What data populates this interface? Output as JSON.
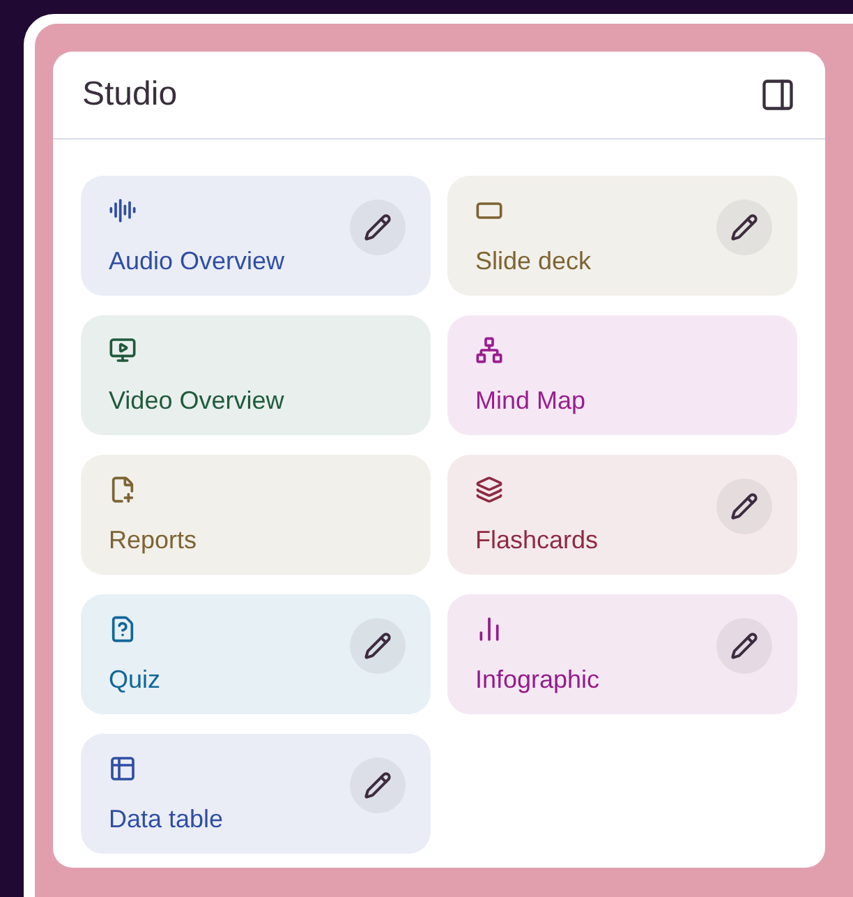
{
  "panel": {
    "title": "Studio"
  },
  "tiles": [
    {
      "kind": "audio",
      "label": "Audio Overview",
      "color": "#2f4ea3",
      "has_edit": true
    },
    {
      "kind": "slides",
      "label": "Slide deck",
      "color": "#7d6432",
      "has_edit": true
    },
    {
      "kind": "video",
      "label": "Video Overview",
      "color": "#1f5a3c",
      "has_edit": false
    },
    {
      "kind": "mindmap",
      "label": "Mind Map",
      "color": "#9a1d8f",
      "has_edit": false
    },
    {
      "kind": "reports",
      "label": "Reports",
      "color": "#7d6432",
      "has_edit": false
    },
    {
      "kind": "flashcards",
      "label": "Flashcards",
      "color": "#8e2a43",
      "has_edit": true
    },
    {
      "kind": "quiz",
      "label": "Quiz",
      "color": "#11679a",
      "has_edit": true
    },
    {
      "kind": "infographic",
      "label": "Infographic",
      "color": "#931c8a",
      "has_edit": true
    },
    {
      "kind": "table",
      "label": "Data table",
      "color": "#2f4ea3",
      "has_edit": true
    }
  ]
}
